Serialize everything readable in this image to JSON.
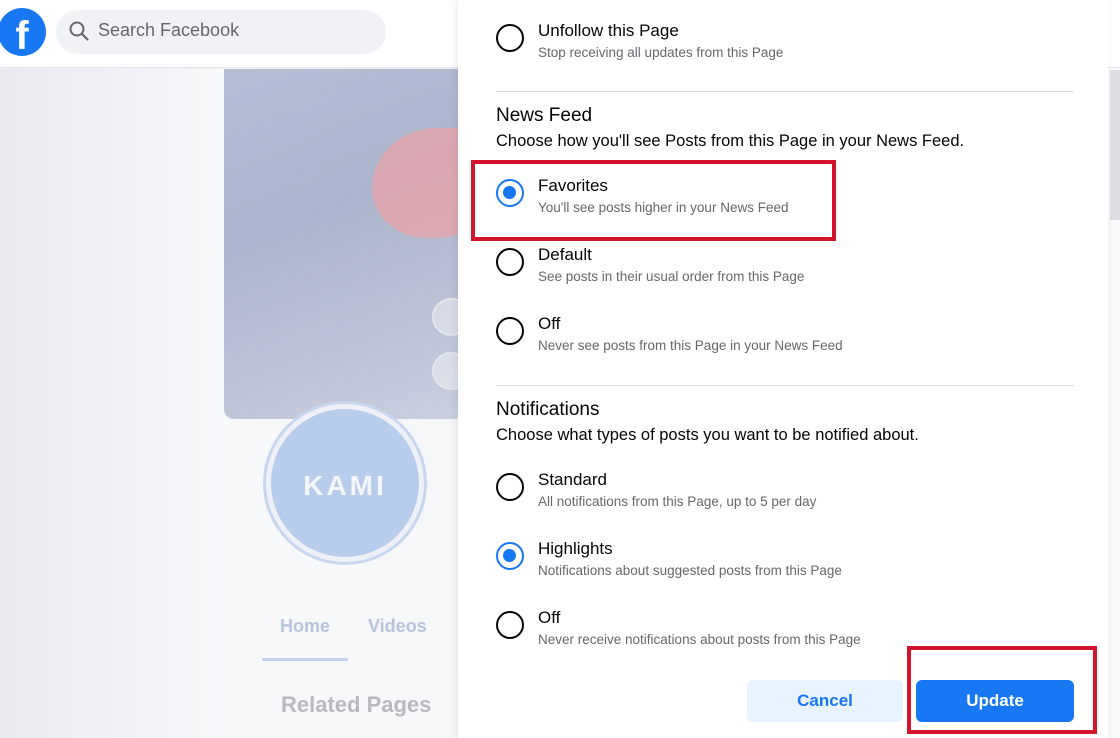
{
  "header": {
    "logo": "f",
    "search_placeholder": "Search Facebook"
  },
  "background_page": {
    "avatar_text": "KAMI",
    "tabs": [
      "Home",
      "Videos"
    ],
    "related_title": "Related Pages"
  },
  "dialog": {
    "follow_options": [
      {
        "title": "Unfollow this Page",
        "desc": "Stop receiving all updates from this Page",
        "selected": false
      }
    ],
    "news_feed": {
      "title": "News Feed",
      "desc": "Choose how you'll see Posts from this Page in your News Feed.",
      "options": [
        {
          "title": "Favorites",
          "desc": "You'll see posts higher in your News Feed",
          "selected": true
        },
        {
          "title": "Default",
          "desc": "See posts in their usual order from this Page",
          "selected": false
        },
        {
          "title": "Off",
          "desc": "Never see posts from this Page in your News Feed",
          "selected": false
        }
      ]
    },
    "notifications": {
      "title": "Notifications",
      "desc": "Choose what types of posts you want to be notified about.",
      "options": [
        {
          "title": "Standard",
          "desc": "All notifications from this Page, up to 5 per day",
          "selected": false
        },
        {
          "title": "Highlights",
          "desc": "Notifications about suggested posts from this Page",
          "selected": true
        },
        {
          "title": "Off",
          "desc": "Never receive notifications about posts from this Page",
          "selected": false
        }
      ]
    },
    "buttons": {
      "cancel": "Cancel",
      "update": "Update"
    }
  },
  "colors": {
    "accent": "#1877f2",
    "highlight_annotation": "#d4142a"
  }
}
